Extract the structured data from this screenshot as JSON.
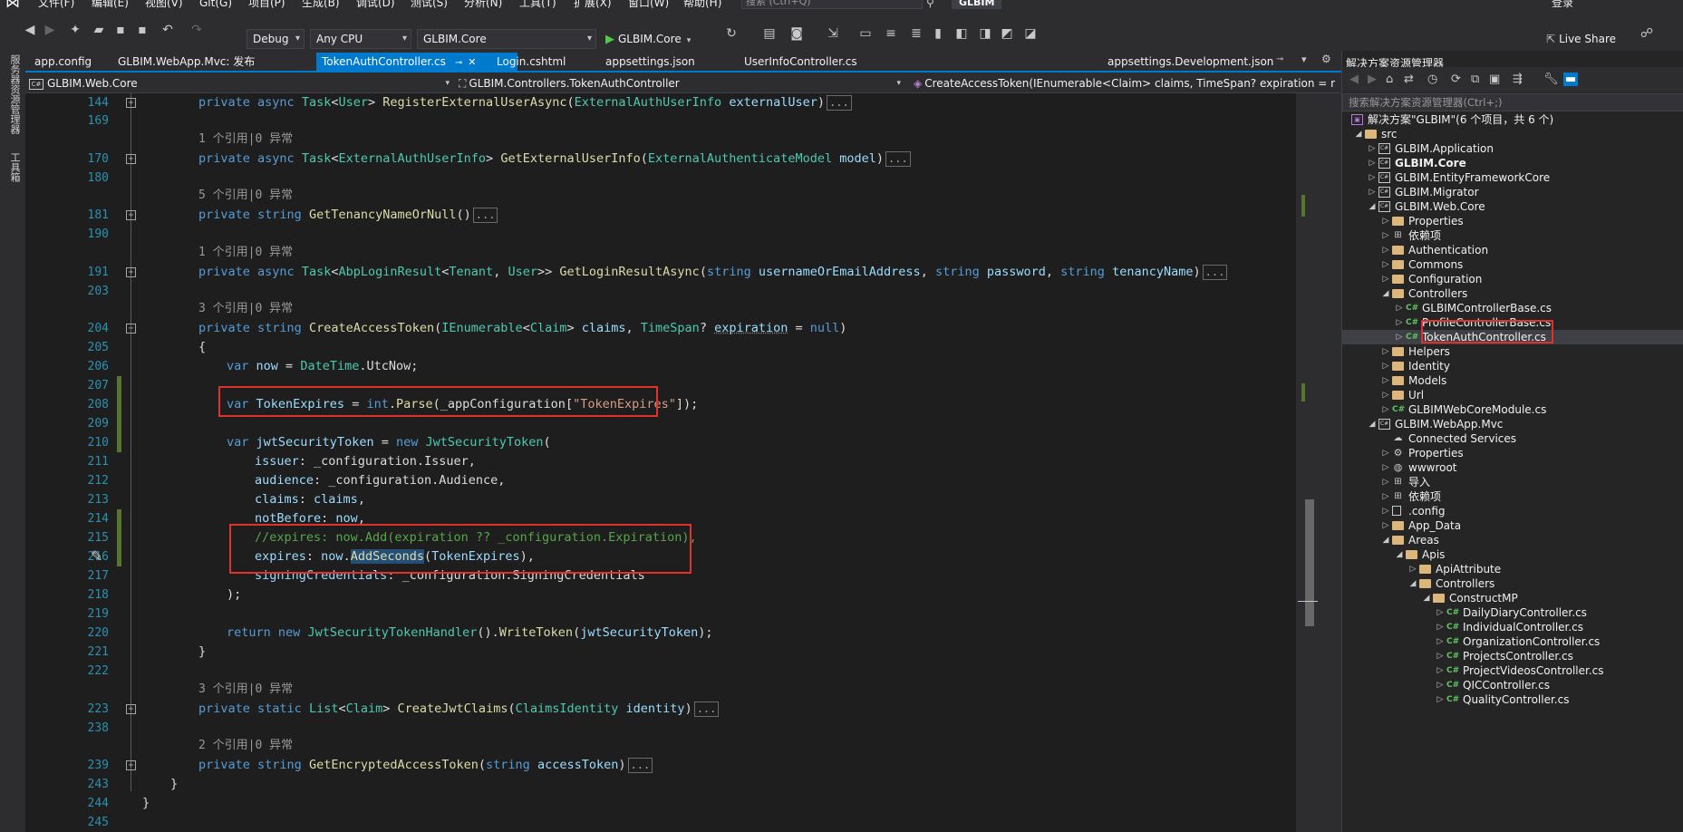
{
  "menu": {
    "items": [
      "文件(F)",
      "编辑(E)",
      "视图(V)",
      "Git(G)",
      "项目(P)",
      "生成(B)",
      "调试(D)",
      "测试(S)",
      "分析(N)",
      "工具(T)",
      "扩展(X)",
      "窗口(W)",
      "帮助(H)"
    ],
    "quick_launch_placeholder": "搜索 (Ctrl+Q)",
    "solution_title": "GLBIM",
    "login": "登录"
  },
  "toolbar": {
    "config": "Debug",
    "platform": "Any CPU",
    "startup_project": "GLBIM.Core",
    "run_label": "GLBIM.Core",
    "live_share": "Live Share"
  },
  "left_strip": [
    "服务器资源管理器",
    "工具箱"
  ],
  "tabs": [
    {
      "label": "app.config",
      "active": false
    },
    {
      "label": "GLBIM.WebApp.Mvc: 发布",
      "active": false
    },
    {
      "label": "TokenAuthController.cs",
      "active": true
    },
    {
      "label": "Login.cshtml",
      "active": false
    },
    {
      "label": "appsettings.json",
      "active": false
    },
    {
      "label": "UserInfoController.cs",
      "active": false
    },
    {
      "label": "appsettings.Development.json",
      "active": false
    }
  ],
  "navbar": {
    "project": "GLBIM.Web.Core",
    "type": "GLBIM.Controllers.TokenAuthController",
    "member": "CreateAccessToken(IEnumerable<Claim> claims, TimeSpan? expiration = r"
  },
  "editor": {
    "line_numbers": [
      "144",
      "169",
      "",
      "170",
      "180",
      "",
      "181",
      "190",
      "",
      "191",
      "203",
      "",
      "204",
      "205",
      "206",
      "207",
      "208",
      "209",
      "210",
      "211",
      "212",
      "213",
      "214",
      "215",
      "216",
      "217",
      "218",
      "219",
      "220",
      "221",
      "222",
      "",
      "223",
      "238",
      "",
      "239",
      "243",
      "244",
      "245"
    ],
    "lens": {
      "one_ref": "1 个引用|0 异常",
      "five_ref": "5 个引用|0 异常",
      "three_ref": "3 个引用|0 异常",
      "two_ref": "2 个引用|0 异常"
    },
    "collapsed": "..."
  },
  "solution_explorer": {
    "title": "解决方案资源管理器",
    "search_placeholder": "搜索解决方案资源管理器(Ctrl+;)",
    "items": [
      {
        "label": "解决方案\"GLBIM\"(6 个项目，共 6 个)",
        "depth": 0,
        "icon": "sol",
        "arrow": ""
      },
      {
        "label": "src",
        "depth": 1,
        "icon": "folder",
        "arrow": "open"
      },
      {
        "label": "GLBIM.Application",
        "depth": 2,
        "icon": "proj",
        "arrow": "closed"
      },
      {
        "label": "GLBIM.Core",
        "depth": 2,
        "icon": "proj",
        "arrow": "closed",
        "bold": true
      },
      {
        "label": "GLBIM.EntityFrameworkCore",
        "depth": 2,
        "icon": "proj",
        "arrow": "closed"
      },
      {
        "label": "GLBIM.Migrator",
        "depth": 2,
        "icon": "proj",
        "arrow": "closed"
      },
      {
        "label": "GLBIM.Web.Core",
        "depth": 2,
        "icon": "proj",
        "arrow": "open"
      },
      {
        "label": "Properties",
        "depth": 3,
        "icon": "folder",
        "arrow": "closed"
      },
      {
        "label": "依赖项",
        "depth": 3,
        "icon": "dep",
        "arrow": "closed"
      },
      {
        "label": "Authentication",
        "depth": 3,
        "icon": "folder",
        "arrow": "closed"
      },
      {
        "label": "Commons",
        "depth": 3,
        "icon": "folder",
        "arrow": "closed"
      },
      {
        "label": "Configuration",
        "depth": 3,
        "icon": "folder",
        "arrow": "closed"
      },
      {
        "label": "Controllers",
        "depth": 3,
        "icon": "folder",
        "arrow": "open"
      },
      {
        "label": "GLBIMControllerBase.cs",
        "depth": 4,
        "icon": "cs",
        "arrow": "closed"
      },
      {
        "label": "ProfileControllerBase.cs",
        "depth": 4,
        "icon": "cs",
        "arrow": "closed"
      },
      {
        "label": "TokenAuthController.cs",
        "depth": 4,
        "icon": "cs",
        "arrow": "closed",
        "selected": true
      },
      {
        "label": "Helpers",
        "depth": 3,
        "icon": "folder",
        "arrow": "closed"
      },
      {
        "label": "Identity",
        "depth": 3,
        "icon": "folder",
        "arrow": "closed"
      },
      {
        "label": "Models",
        "depth": 3,
        "icon": "folder",
        "arrow": "closed"
      },
      {
        "label": "Url",
        "depth": 3,
        "icon": "folder",
        "arrow": "closed"
      },
      {
        "label": "GLBIMWebCoreModule.cs",
        "depth": 3,
        "icon": "cs",
        "arrow": "closed"
      },
      {
        "label": "GLBIM.WebApp.Mvc",
        "depth": 2,
        "icon": "proj",
        "arrow": "open"
      },
      {
        "label": "Connected Services",
        "depth": 3,
        "icon": "cloud",
        "arrow": ""
      },
      {
        "label": "Properties",
        "depth": 3,
        "icon": "gear",
        "arrow": "closed"
      },
      {
        "label": "wwwroot",
        "depth": 3,
        "icon": "globe",
        "arrow": "closed"
      },
      {
        "label": "导入",
        "depth": 3,
        "icon": "dep",
        "arrow": "closed"
      },
      {
        "label": "依赖项",
        "depth": 3,
        "icon": "dep",
        "arrow": "closed"
      },
      {
        "label": ".config",
        "depth": 3,
        "icon": "file",
        "arrow": "closed"
      },
      {
        "label": "App_Data",
        "depth": 3,
        "icon": "folder",
        "arrow": "closed"
      },
      {
        "label": "Areas",
        "depth": 3,
        "icon": "folder",
        "arrow": "open"
      },
      {
        "label": "Apis",
        "depth": 4,
        "icon": "folder",
        "arrow": "open"
      },
      {
        "label": "ApiAttribute",
        "depth": 5,
        "icon": "folder",
        "arrow": "closed"
      },
      {
        "label": "Controllers",
        "depth": 5,
        "icon": "folder",
        "arrow": "open"
      },
      {
        "label": "ConstructMP",
        "depth": 6,
        "icon": "folder",
        "arrow": "open"
      },
      {
        "label": "DailyDiaryController.cs",
        "depth": 7,
        "icon": "cs",
        "arrow": "closed"
      },
      {
        "label": "IndividualController.cs",
        "depth": 7,
        "icon": "cs",
        "arrow": "closed"
      },
      {
        "label": "OrganizationController.cs",
        "depth": 7,
        "icon": "cs",
        "arrow": "closed"
      },
      {
        "label": "ProjectsController.cs",
        "depth": 7,
        "icon": "cs",
        "arrow": "closed"
      },
      {
        "label": "ProjectVideosController.cs",
        "depth": 7,
        "icon": "cs",
        "arrow": "closed"
      },
      {
        "label": "QICController.cs",
        "depth": 7,
        "icon": "cs",
        "arrow": "closed"
      },
      {
        "label": "QualityController.cs",
        "depth": 7,
        "icon": "cs",
        "arrow": "closed"
      }
    ]
  }
}
